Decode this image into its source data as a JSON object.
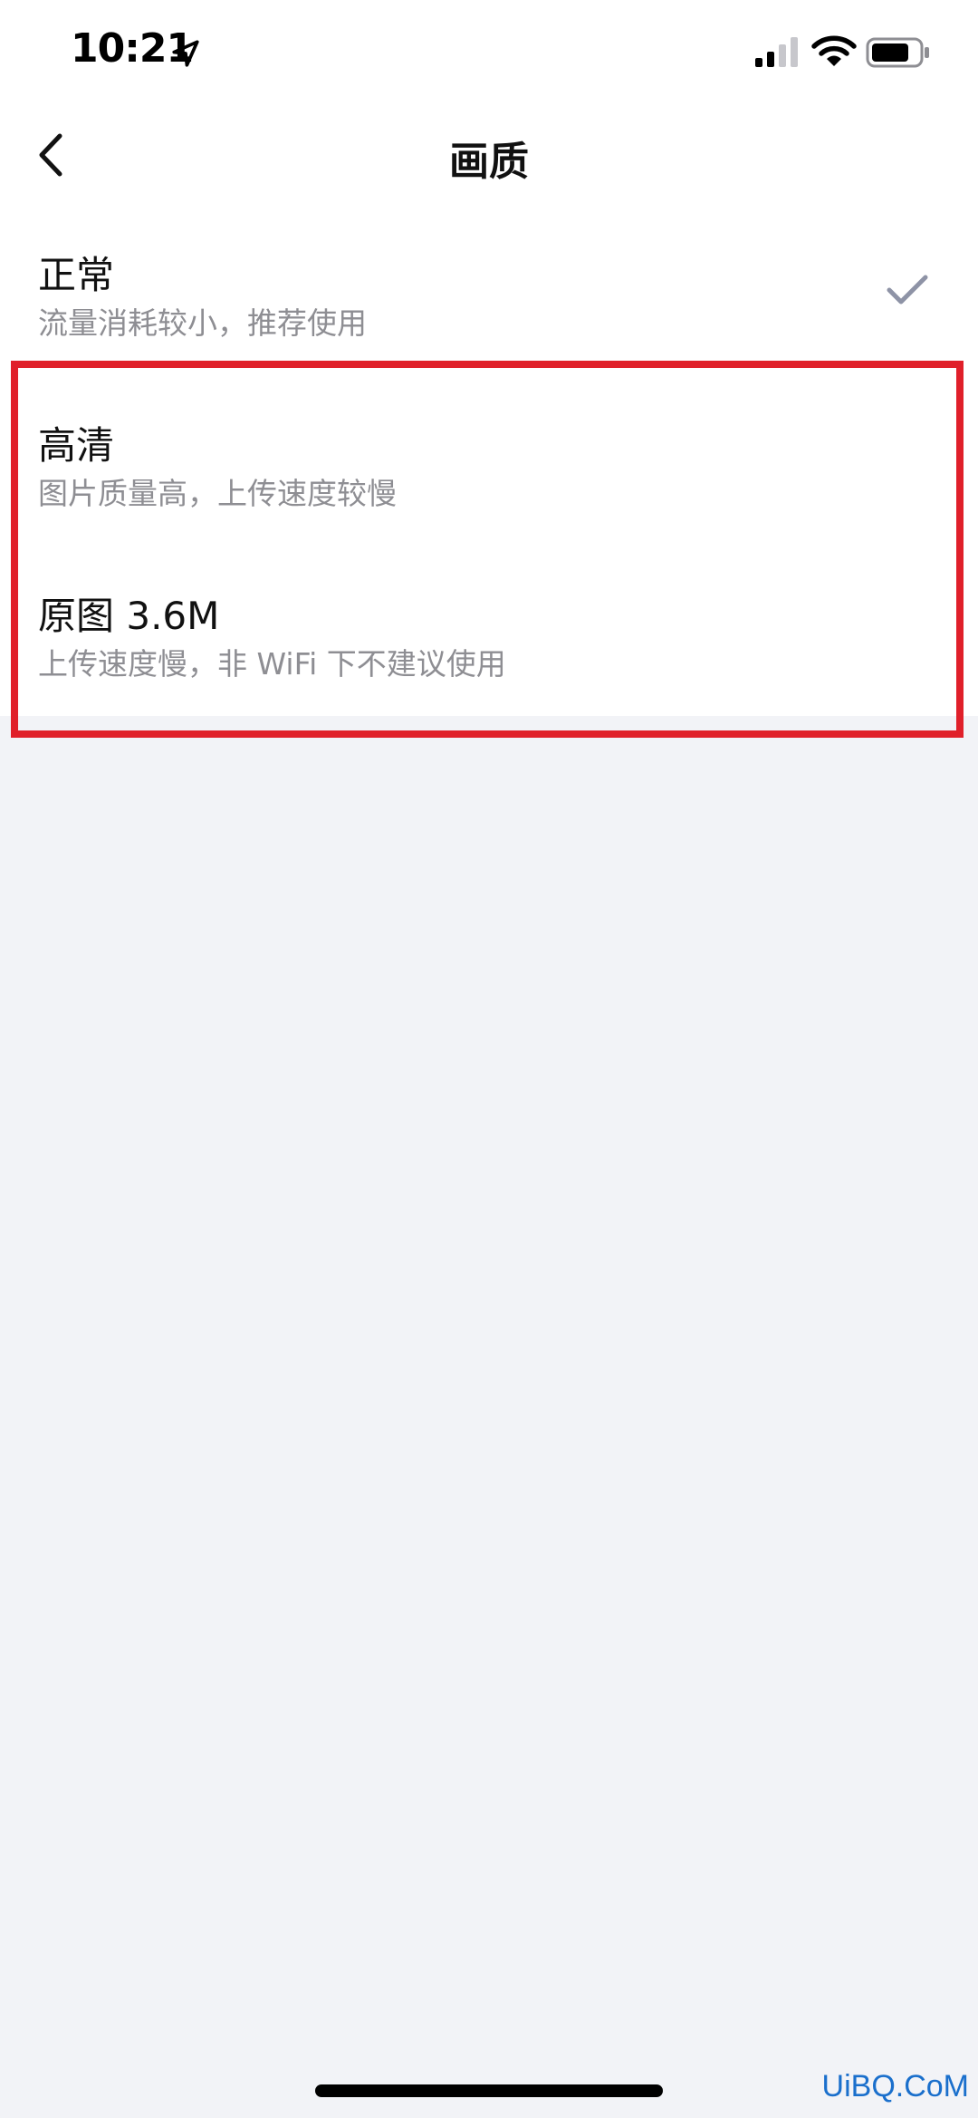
{
  "status_bar": {
    "time": "10:21",
    "icons": [
      "location-arrow-icon",
      "cellular-signal-icon",
      "wifi-icon",
      "battery-icon"
    ]
  },
  "nav": {
    "back_icon": "chevron-left-icon",
    "title": "画质"
  },
  "options": [
    {
      "title": "正常",
      "description": "流量消耗较小，推荐使用",
      "selected": true
    },
    {
      "title": "高清",
      "description": "图片质量高，上传速度较慢",
      "selected": false
    },
    {
      "title": "原图 3.6M",
      "description": "上传速度慢，非 WiFi 下不建议使用",
      "selected": false
    }
  ],
  "colors": {
    "highlight": "#e0202a",
    "check": "#8e93a6",
    "background": "#f2f3f7",
    "watermark": "#1a6fcc"
  },
  "watermark": "UiBQ.CoM"
}
